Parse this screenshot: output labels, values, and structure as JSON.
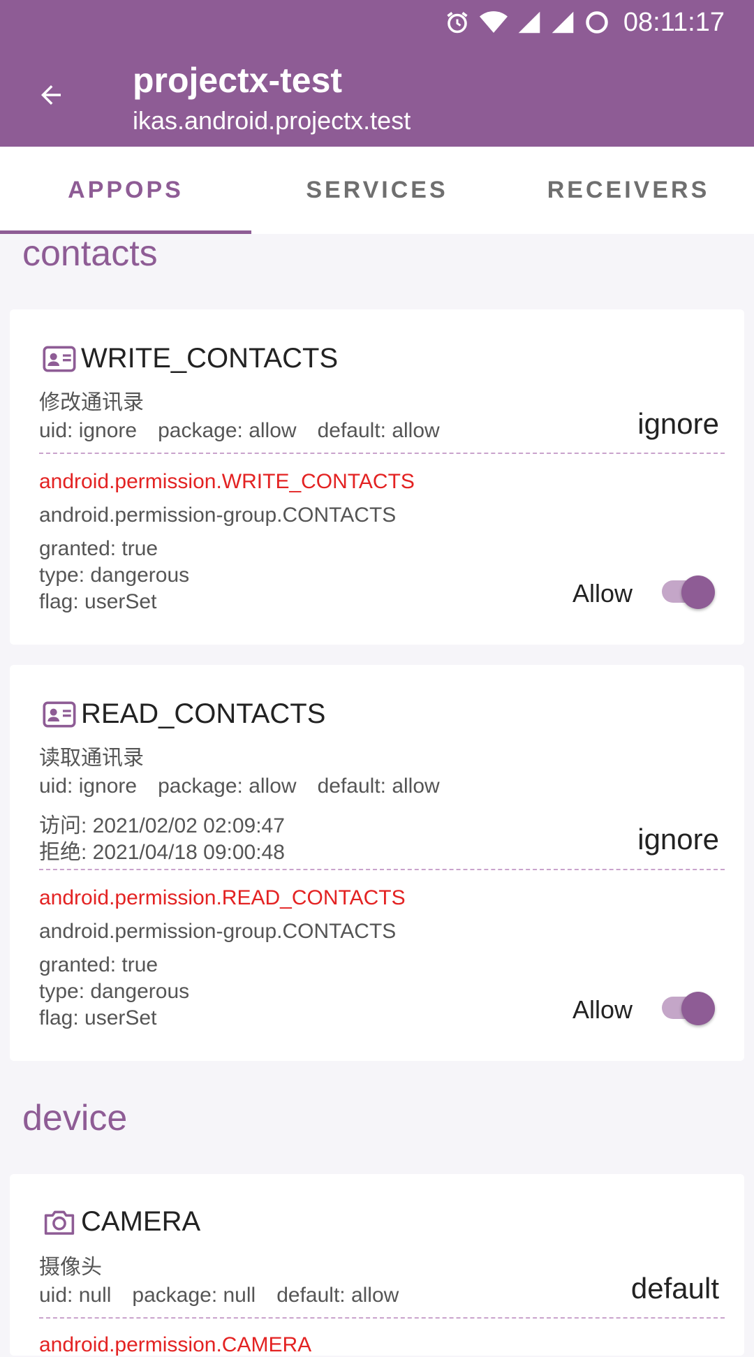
{
  "status_bar": {
    "time": "08:11:17"
  },
  "app_bar": {
    "title": "projectx-test",
    "subtitle": "ikas.android.projectx.test"
  },
  "tabs": [
    {
      "label": "APPOPS"
    },
    {
      "label": "SERVICES"
    },
    {
      "label": "RECEIVERS"
    }
  ],
  "sections": {
    "contacts": {
      "title": "contacts"
    },
    "device": {
      "title": "device"
    }
  },
  "cards": {
    "write_contacts": {
      "name": "WRITE_CONTACTS",
      "desc": "修改通讯录",
      "uid": "uid: ignore",
      "package": "package: allow",
      "default": "default: allow",
      "mode": "ignore",
      "permission": "android.permission.WRITE_CONTACTS",
      "group": "android.permission-group.CONTACTS",
      "granted": "granted: true",
      "type": "type: dangerous",
      "flag": "flag: userSet",
      "switch_label": "Allow"
    },
    "read_contacts": {
      "name": "READ_CONTACTS",
      "desc": "读取通讯录",
      "uid": "uid: ignore",
      "package": "package: allow",
      "default": "default: allow",
      "access": "访问: 2021/02/02 02:09:47",
      "reject": "拒绝: 2021/04/18 09:00:48",
      "mode": "ignore",
      "permission": "android.permission.READ_CONTACTS",
      "group": "android.permission-group.CONTACTS",
      "granted": "granted: true",
      "type": "type: dangerous",
      "flag": "flag: userSet",
      "switch_label": "Allow"
    },
    "camera": {
      "name": "CAMERA",
      "desc": "摄像头",
      "uid": "uid: null",
      "package": "package: null",
      "default": "default: allow",
      "mode": "default",
      "permission": "android.permission.CAMERA"
    }
  },
  "colors": {
    "accent": "#8e5c95",
    "permission_red": "#e32222",
    "background": "#f6f5f9"
  }
}
